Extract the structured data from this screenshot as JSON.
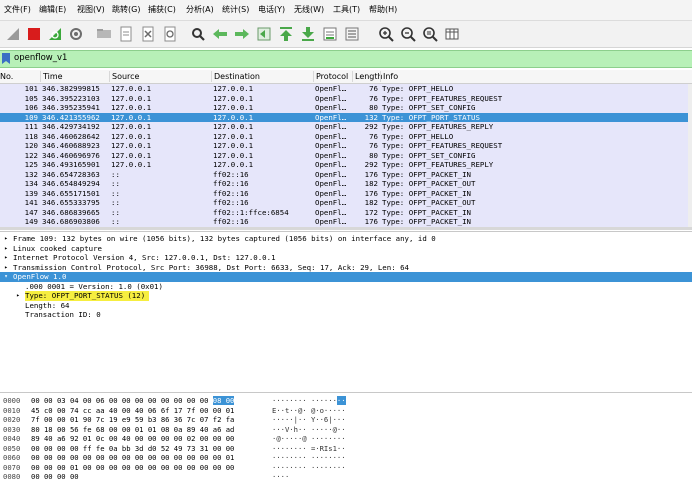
{
  "menu": [
    "文件(F)",
    "编辑(E)",
    "视图(V)",
    "跳转(G)",
    "捕获(C)",
    "分析(A)",
    "统计(S)",
    "电话(Y)",
    "无线(W)",
    "工具(T)",
    "帮助(H)"
  ],
  "toolbar_icons": [
    "shark-fin-start-icon",
    "stop-capture-icon",
    "restart-capture-icon",
    "capture-options-icon",
    "open-file-icon",
    "save-file-icon",
    "close-file-icon",
    "reload-file-icon",
    "find-packet-icon",
    "go-back-icon",
    "go-forward-icon",
    "go-to-packet-icon",
    "go-first-icon",
    "go-last-icon",
    "autoscroll-icon",
    "colorize-icon",
    "zoom-in-icon",
    "zoom-out-icon",
    "zoom-normal-icon",
    "resize-columns-icon"
  ],
  "filter": {
    "value": "openflow_v1"
  },
  "packet_list": {
    "columns": [
      "No.",
      "Time",
      "Source",
      "Destination",
      "Protocol",
      "Length",
      "Info"
    ],
    "rows": [
      {
        "no": "101",
        "time": "346.382999815",
        "src": "127.0.0.1",
        "dst": "127.0.0.1",
        "proto": "OpenFl…",
        "len": "76",
        "info": "Type: OFPT_HELLO"
      },
      {
        "no": "105",
        "time": "346.395223103",
        "src": "127.0.0.1",
        "dst": "127.0.0.1",
        "proto": "OpenFl…",
        "len": "76",
        "info": "Type: OFPT_FEATURES_REQUEST"
      },
      {
        "no": "106",
        "time": "346.395235941",
        "src": "127.0.0.1",
        "dst": "127.0.0.1",
        "proto": "OpenFl…",
        "len": "80",
        "info": "Type: OFPT_SET_CONFIG"
      },
      {
        "no": "109",
        "time": "346.421355962",
        "src": "127.0.0.1",
        "dst": "127.0.0.1",
        "proto": "OpenFl…",
        "len": "132",
        "info": "Type: OFPT_PORT_STATUS",
        "selected": true
      },
      {
        "no": "111",
        "time": "346.429734192",
        "src": "127.0.0.1",
        "dst": "127.0.0.1",
        "proto": "OpenFl…",
        "len": "292",
        "info": "Type: OFPT_FEATURES_REPLY"
      },
      {
        "no": "118",
        "time": "346.460628642",
        "src": "127.0.0.1",
        "dst": "127.0.0.1",
        "proto": "OpenFl…",
        "len": "76",
        "info": "Type: OFPT_HELLO"
      },
      {
        "no": "120",
        "time": "346.460688923",
        "src": "127.0.0.1",
        "dst": "127.0.0.1",
        "proto": "OpenFl…",
        "len": "76",
        "info": "Type: OFPT_FEATURES_REQUEST"
      },
      {
        "no": "122",
        "time": "346.460696976",
        "src": "127.0.0.1",
        "dst": "127.0.0.1",
        "proto": "OpenFl…",
        "len": "80",
        "info": "Type: OFPT_SET_CONFIG"
      },
      {
        "no": "125",
        "time": "346.493165901",
        "src": "127.0.0.1",
        "dst": "127.0.0.1",
        "proto": "OpenFl…",
        "len": "292",
        "info": "Type: OFPT_FEATURES_REPLY"
      },
      {
        "no": "132",
        "time": "346.654728363",
        "src": "::",
        "dst": "ff02::16",
        "proto": "OpenFl…",
        "len": "176",
        "info": "Type: OFPT_PACKET_IN"
      },
      {
        "no": "134",
        "time": "346.654849294",
        "src": "::",
        "dst": "ff02::16",
        "proto": "OpenFl…",
        "len": "182",
        "info": "Type: OFPT_PACKET_OUT"
      },
      {
        "no": "139",
        "time": "346.655171501",
        "src": "::",
        "dst": "ff02::16",
        "proto": "OpenFl…",
        "len": "176",
        "info": "Type: OFPT_PACKET_IN"
      },
      {
        "no": "141",
        "time": "346.655333795",
        "src": "::",
        "dst": "ff02::16",
        "proto": "OpenFl…",
        "len": "182",
        "info": "Type: OFPT_PACKET_OUT"
      },
      {
        "no": "147",
        "time": "346.686839665",
        "src": "::",
        "dst": "ff02::1:ffce:6854",
        "proto": "OpenFl…",
        "len": "172",
        "info": "Type: OFPT_PACKET_IN"
      },
      {
        "no": "149",
        "time": "346.686903806",
        "src": "::",
        "dst": "ff02::16",
        "proto": "OpenFl…",
        "len": "176",
        "info": "Type: OFPT_PACKET_IN"
      },
      {
        "no": "151",
        "time": "346.687019779",
        "src": "::",
        "dst": "ff02::1:ffce:6854",
        "proto": "OpenFl…",
        "len": "178",
        "info": "Type: OFPT_PACKET_OUT"
      }
    ]
  },
  "details": [
    {
      "arrow": "▸",
      "indent": 0,
      "text": "Frame 109: 132 bytes on wire (1056 bits), 132 bytes captured (1056 bits) on interface any, id 0"
    },
    {
      "arrow": "▸",
      "indent": 0,
      "text": "Linux cooked capture"
    },
    {
      "arrow": "▸",
      "indent": 0,
      "text": "Internet Protocol Version 4, Src: 127.0.0.1, Dst: 127.0.0.1"
    },
    {
      "arrow": "▸",
      "indent": 0,
      "text": "Transmission Control Protocol, Src Port: 36988, Dst Port: 6633, Seq: 17, Ack: 29, Len: 64"
    },
    {
      "arrow": "▾",
      "indent": 0,
      "text": "OpenFlow 1.0",
      "selected": true
    },
    {
      "arrow": "",
      "indent": 2,
      "text": ".000 0001 = Version: 1.0 (0x01)"
    },
    {
      "arrow": "▸",
      "indent": 2,
      "text": "Type: OFPT_PORT_STATUS (12)",
      "highlight": true
    },
    {
      "arrow": "",
      "indent": 2,
      "text": "Length: 64"
    },
    {
      "arrow": "",
      "indent": 2,
      "text": "Transaction ID: 0"
    }
  ],
  "bytes": [
    {
      "off": "0000",
      "hex": "00 00 03 04 00 06 00 00  00 00 00 00 00 00",
      "hexhl": "08 00",
      "ascii": "········ ······",
      "asciihl": "··"
    },
    {
      "off": "0010",
      "hex": "45 c0 00 74 cc aa 40 00  40 06 6f 17 7f 00 00 01",
      "ascii": "E··t··@· @·o·····"
    },
    {
      "off": "0020",
      "hex": "7f 00 00 01 90 7c 19 e9  59 b3 86 36 7c 07 f2 fa",
      "ascii": "·····|·· Y··6|···"
    },
    {
      "off": "0030",
      "hex": "80 18 00 56 fe 68 00 00  01 01 08 0a 89 40 a6 ad",
      "ascii": "···V·h·· ·····@··"
    },
    {
      "off": "0040",
      "hex": "89 40 a6 92 01 0c 00 40  00 00 00 00 02 00 00 00",
      "ascii": "·@·····@ ········"
    },
    {
      "off": "0050",
      "hex": "00 00 00 00 ff fe 0a bb  3d d0 52 49 73 31 00 00",
      "ascii": "········ =·RIs1··"
    },
    {
      "off": "0060",
      "hex": "00 00 00 00 00 00 00 00  00 00 00 00 00 00 00 01",
      "ascii": "········ ········"
    },
    {
      "off": "0070",
      "hex": "00 00 00 01 00 00 00 00  00 00 00 00 00 00 00 00",
      "ascii": "········ ········"
    },
    {
      "off": "0080",
      "hex": "00 00 00 00",
      "ascii": "····"
    }
  ],
  "colors": {
    "selected": "#3c93d6",
    "row_bg": "#e6e6fa",
    "filter_bg": "#b7f0b7",
    "highlight": "#f6ee40"
  }
}
